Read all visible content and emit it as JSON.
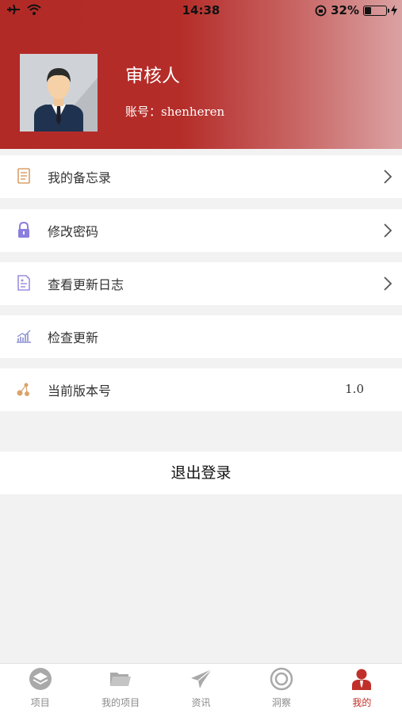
{
  "status_bar": {
    "time": "14:38",
    "battery_percent": "32%",
    "battery_level": 0.32,
    "icons": [
      "airplane-icon",
      "wifi-icon",
      "orientation-lock-icon",
      "battery-icon",
      "charging-icon"
    ]
  },
  "profile": {
    "name": "审核人",
    "account_label": "账号：",
    "account_value": "shenheren"
  },
  "menu": {
    "items": [
      {
        "label": "我的备忘录",
        "icon": "memo-icon",
        "has_chevron": true
      },
      {
        "label": "修改密码",
        "icon": "lock-icon",
        "has_chevron": true
      },
      {
        "label": "查看更新日志",
        "icon": "log-document-icon",
        "has_chevron": true
      },
      {
        "label": "检查更新",
        "icon": "chart-update-icon",
        "has_chevron": false
      },
      {
        "label": "当前版本号",
        "icon": "version-icon",
        "has_chevron": false,
        "value": "1.0"
      }
    ]
  },
  "logout": {
    "label": "退出登录"
  },
  "tabbar": {
    "tabs": [
      {
        "label": "项目",
        "icon": "layers-icon",
        "active": false
      },
      {
        "label": "我的项目",
        "icon": "folder-icon",
        "active": false
      },
      {
        "label": "资讯",
        "icon": "paper-plane-icon",
        "active": false
      },
      {
        "label": "洞察",
        "icon": "eye-target-icon",
        "active": false
      },
      {
        "label": "我的",
        "icon": "user-icon",
        "active": true
      }
    ]
  },
  "colors": {
    "header_red": "#b22a26",
    "active_tab": "#c0302a",
    "inactive_tab": "#8a8a8a"
  }
}
